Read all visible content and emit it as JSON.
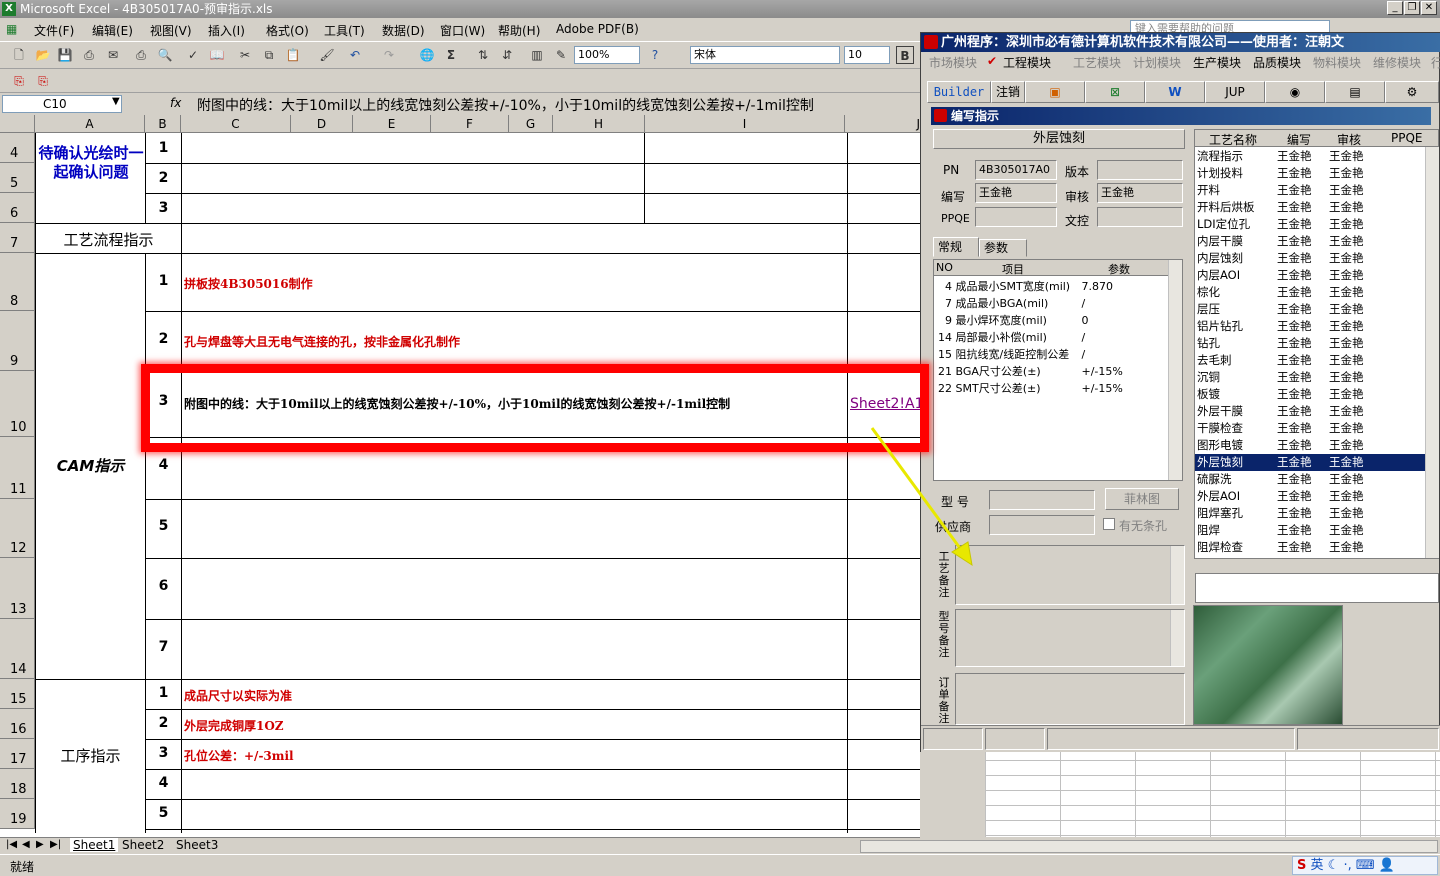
{
  "excel": {
    "title": "Microsoft Excel - 4B305017A0-预审指示.xls",
    "menu": [
      "文件(F)",
      "编辑(E)",
      "视图(V)",
      "插入(I)",
      "格式(O)",
      "工具(T)",
      "数据(D)",
      "窗口(W)",
      "帮助(H)",
      "Adobe PDF(B)"
    ],
    "help_placeholder": "键入需要帮助的问题",
    "zoom": "100%",
    "font_name": "宋体",
    "font_size": "10",
    "bold_label": "B",
    "namebox": "C10",
    "fx": "fx",
    "formula": "附图中的线：大于10mil以上的线宽蚀刻公差按+/-10%，小于10mil的线宽蚀刻公差按+/-1mil控制",
    "columns": [
      "A",
      "B",
      "C",
      "D",
      "E",
      "F",
      "G",
      "H",
      "I",
      "J"
    ],
    "rows": [
      "4",
      "5",
      "6",
      "7",
      "8",
      "9",
      "10",
      "11",
      "12",
      "13",
      "14",
      "15",
      "16",
      "17",
      "18",
      "19"
    ],
    "confirm_label": "待确认光绘时一起确认问题",
    "confirm_nums": [
      "1",
      "2",
      "3"
    ],
    "flow_label": "工艺流程指示",
    "cam_label": "CAM指示",
    "cam_nums": [
      "1",
      "2",
      "3",
      "4",
      "5",
      "6",
      "7"
    ],
    "cam_items": [
      "拼板按4B305016制作",
      "孔与焊盘等大且无电气连接的孔，按非金属化孔制作",
      "附图中的线：大于10mil以上的线宽蚀刻公差按+/-10%，小于10mil的线宽蚀刻公差按+/-1mil控制"
    ],
    "link_text": "Sheet2!A1",
    "proc_label": "工序指示",
    "proc_nums": [
      "1",
      "2",
      "3",
      "4",
      "5"
    ],
    "proc_items": [
      "成品尺寸以实际为准",
      "外层完成铜厚1OZ",
      "孔位公差：+/-3mil"
    ],
    "sheet_tabs": [
      "Sheet1",
      "Sheet2",
      "Sheet3"
    ],
    "status": "就绪",
    "ime": "英"
  },
  "app": {
    "title": "广州程序：深圳市必有德计算机软件技术有限公司——使用者：汪朝文",
    "modules": [
      "市场模块",
      "工程模块",
      "工艺模块",
      "计划模块",
      "生产模块",
      "品质模块",
      "物料模块",
      "维修模块",
      "行"
    ],
    "toolbar": [
      "Builder",
      "注销",
      "JUP"
    ],
    "subwindow_title": "编写指示",
    "section": "外层蚀刻",
    "fields": {
      "pn_label": "PN",
      "pn_value": "4B305017A0",
      "version_label": "版本",
      "version_value": "",
      "writer_label": "编写",
      "writer_value": "王金艳",
      "reviewer_label": "审核",
      "reviewer_value": "王金艳",
      "ppqe_label": "PPQE",
      "ppqe_value": "",
      "doc_label": "文控",
      "doc_value": ""
    },
    "tabs": [
      "常规",
      "参数"
    ],
    "param_headers": [
      "NO",
      "项目",
      "参数"
    ],
    "params": [
      {
        "no": "4",
        "item": "成品最小SMT宽度(mil)",
        "value": "7.870"
      },
      {
        "no": "7",
        "item": "成品最小BGA(mil)",
        "value": "/"
      },
      {
        "no": "9",
        "item": "最小焊环宽度(mil)",
        "value": "0"
      },
      {
        "no": "14",
        "item": "局部最小补偿(mil)",
        "value": "/"
      },
      {
        "no": "15",
        "item": "阻抗线宽/线距控制公差",
        "value": "/"
      },
      {
        "no": "21",
        "item": "BGA尺寸公差(±)",
        "value": "+/-15%"
      },
      {
        "no": "22",
        "item": "SMT尺寸公差(±)",
        "value": "+/-15%"
      }
    ],
    "model_label": "型  号",
    "supplier_label": "供应商",
    "filmap_button": "菲林图",
    "nohole_checkbox": "有无条孔",
    "memo_labels": [
      "工艺备注",
      "型号备注",
      "订单备注"
    ],
    "proc_headers": [
      "工艺名称",
      "编写",
      "审核",
      "PPQE"
    ],
    "processes": [
      {
        "name": "流程指示",
        "writer": "王金艳",
        "reviewer": "王金艳"
      },
      {
        "name": "计划投料",
        "writer": "王金艳",
        "reviewer": "王金艳"
      },
      {
        "name": "开料",
        "writer": "王金艳",
        "reviewer": "王金艳"
      },
      {
        "name": "开料后烘板",
        "writer": "王金艳",
        "reviewer": "王金艳"
      },
      {
        "name": "LDI定位孔",
        "writer": "王金艳",
        "reviewer": "王金艳"
      },
      {
        "name": "内层干膜",
        "writer": "王金艳",
        "reviewer": "王金艳"
      },
      {
        "name": "内层蚀刻",
        "writer": "王金艳",
        "reviewer": "王金艳"
      },
      {
        "name": "内层AOI",
        "writer": "王金艳",
        "reviewer": "王金艳"
      },
      {
        "name": "棕化",
        "writer": "王金艳",
        "reviewer": "王金艳"
      },
      {
        "name": "层压",
        "writer": "王金艳",
        "reviewer": "王金艳"
      },
      {
        "name": "铝片钻孔",
        "writer": "王金艳",
        "reviewer": "王金艳"
      },
      {
        "name": "钻孔",
        "writer": "王金艳",
        "reviewer": "王金艳"
      },
      {
        "name": "去毛刺",
        "writer": "王金艳",
        "reviewer": "王金艳"
      },
      {
        "name": "沉铜",
        "writer": "王金艳",
        "reviewer": "王金艳"
      },
      {
        "name": "板镀",
        "writer": "王金艳",
        "reviewer": "王金艳"
      },
      {
        "name": "外层干膜",
        "writer": "王金艳",
        "reviewer": "王金艳"
      },
      {
        "name": "干膜检查",
        "writer": "王金艳",
        "reviewer": "王金艳"
      },
      {
        "name": "图形电镀",
        "writer": "王金艳",
        "reviewer": "王金艳"
      },
      {
        "name": "外层蚀刻",
        "writer": "王金艳",
        "reviewer": "王金艳"
      },
      {
        "name": "硫脲洗",
        "writer": "王金艳",
        "reviewer": "王金艳"
      },
      {
        "name": "外层AOI",
        "writer": "王金艳",
        "reviewer": "王金艳"
      },
      {
        "name": "阻焊塞孔",
        "writer": "王金艳",
        "reviewer": "王金艳"
      },
      {
        "name": "阻焊",
        "writer": "王金艳",
        "reviewer": "王金艳"
      },
      {
        "name": "阻焊检查",
        "writer": "王金艳",
        "reviewer": "王金艳"
      }
    ]
  },
  "colors": {
    "highlight": "#ff0000",
    "arrow": "#e8e800",
    "selection": "#0a246a",
    "red_text": "#d00000",
    "blue_text": "#0000c0"
  }
}
